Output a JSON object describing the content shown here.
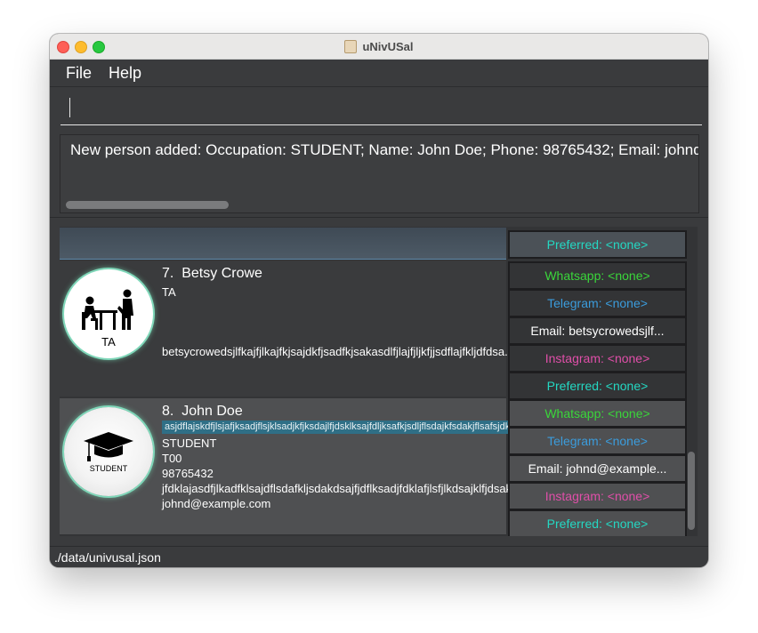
{
  "window": {
    "title": "uNivUSal"
  },
  "menu": {
    "file": "File",
    "help": "Help"
  },
  "command": {
    "value": ""
  },
  "result": {
    "text": "New person added: Occupation: STUDENT; Name: John Doe; Phone: 98765432; Email: johnd@e:"
  },
  "persons": [
    {
      "index": "7.",
      "name": "Betsy Crowe",
      "occupation": "TA",
      "avatar_label": "TA",
      "avatar_icon": "teacher-student-icon",
      "lines": [
        "betsycrowedsjlfkajfjlkajfkjsajdkfjsadfkjsakasdlfjlajfjljkfjjsdflajfkljdfdsa..."
      ],
      "tags": {
        "whatsapp": "Whatsapp: <none>",
        "telegram": "Telegram: <none>",
        "email": "Email: betsycrowedsjlf...",
        "instagram": "Instagram: <none>",
        "preferred": "Preferred: <none>"
      }
    },
    {
      "index": "8.",
      "name": "John Doe",
      "avatar_label": "STUDENT",
      "avatar_icon": "graduation-cap-icon",
      "highlight": "asjdflajskdfjlsjafjksadjflsjklsadjkfjksdajlfjdsklksajfdljksafkjsdljflsdajkfsdakjflsafsjdkfjls",
      "lines": [
        "STUDENT",
        "T00",
        "98765432",
        "jfdklajasdfjlkadfklsajdflsdafkljsdakdsajfjdflksadjfdklafjlsfjlkdsajklfjdsaklk.",
        "johnd@example.com"
      ],
      "tags": {
        "whatsapp": "Whatsapp: <none>",
        "telegram": "Telegram: <none>",
        "email": "Email: johnd@example...",
        "instagram": "Instagram: <none>",
        "preferred": "Preferred: <none>"
      }
    }
  ],
  "previous_card": {
    "preferred": "Preferred: <none>"
  },
  "status": {
    "path": "./data/univusal.json"
  },
  "colors": {
    "whatsapp": "#3ad63a",
    "telegram": "#3b9cdc",
    "email": "#ffffff",
    "instagram": "#e04fa9",
    "preferred": "#24d8c3",
    "avatar_glow": "#7fd7b9"
  }
}
